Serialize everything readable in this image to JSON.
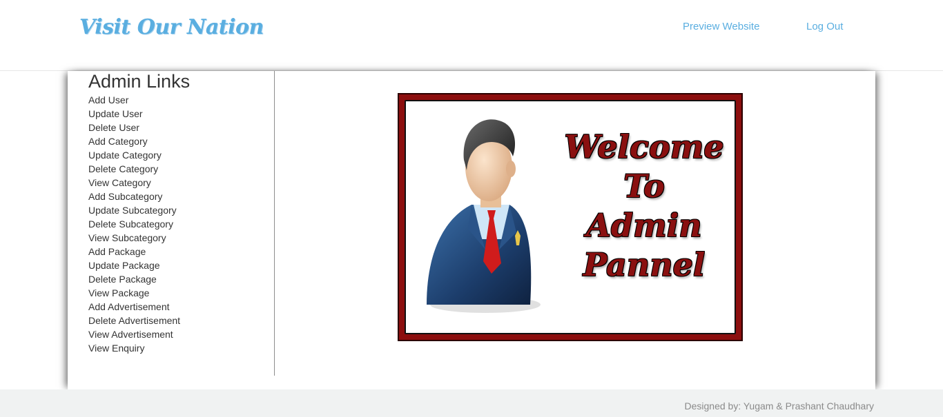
{
  "header": {
    "brand": "Visit Our Nation",
    "nav": {
      "preview": "Preview Website",
      "logout": "Log Out"
    }
  },
  "sidebar": {
    "title": "Admin Links",
    "links": [
      "Add User",
      "Update User",
      "Delete User",
      "Add Category",
      "Update Category",
      "Delete Category",
      "View Category",
      "Add Subcategory",
      "Update Subcategory",
      "Delete Subcategory",
      "View Subcategory",
      "Add Package",
      "Update Package",
      "Delete Package",
      "View Package",
      "Add Advertisement",
      "Delete Advertisement",
      "View Advertisement",
      "View Enquiry"
    ]
  },
  "banner": {
    "text": "Welcome\nTo\nAdmin\nPannel",
    "icon": "admin-user-icon"
  },
  "footer": {
    "credits": "Designed by: Yugam & Prashant Chaudhary"
  },
  "colors": {
    "brand": "#5aaee0",
    "link": "#333333",
    "banner_border": "#8c0f0f",
    "footer_bg": "#f0f2f2"
  }
}
